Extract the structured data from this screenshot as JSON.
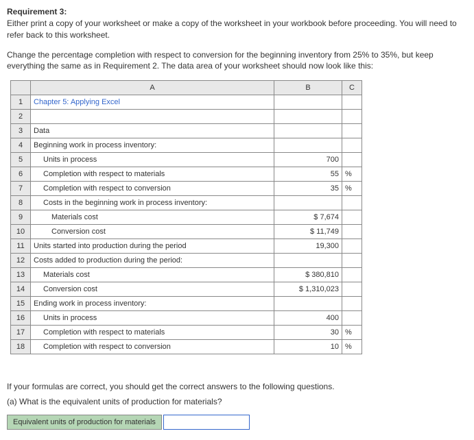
{
  "requirement": {
    "title": "Requirement 3:",
    "paragraph1": "Either print a copy of your worksheet or make a copy of the worksheet in your workbook before proceeding. You will need to refer back to this worksheet.",
    "paragraph2": "Change the percentage completion with respect to conversion for the beginning inventory from 25% to 35%, but keep everything the same as in Requirement 2. The data area of your worksheet should now look like this:"
  },
  "headers": {
    "colA": "A",
    "colB": "B",
    "colC": "C"
  },
  "rows": [
    {
      "num": "1",
      "a": "Chapter 5: Applying Excel",
      "b": "",
      "c": "",
      "blue": true
    },
    {
      "num": "2",
      "a": "",
      "b": "",
      "c": ""
    },
    {
      "num": "3",
      "a": "Data",
      "b": "",
      "c": ""
    },
    {
      "num": "4",
      "a": "Beginning work in process inventory:",
      "b": "",
      "c": ""
    },
    {
      "num": "5",
      "a": "Units in process",
      "b": "700",
      "c": "",
      "indent": 1
    },
    {
      "num": "6",
      "a": "Completion with respect to materials",
      "b": "55",
      "c": "%",
      "indent": 1
    },
    {
      "num": "7",
      "a": "Completion with respect to conversion",
      "b": "35",
      "c": "%",
      "indent": 1
    },
    {
      "num": "8",
      "a": "Costs in the beginning work in process inventory:",
      "b": "",
      "c": "",
      "indent": 1
    },
    {
      "num": "9",
      "a": "Materials cost",
      "b": "$      7,674",
      "c": "",
      "indent": 2
    },
    {
      "num": "10",
      "a": "Conversion cost",
      "b": "$     11,749",
      "c": "",
      "indent": 2
    },
    {
      "num": "11",
      "a": "Units started into production during the period",
      "b": "19,300",
      "c": ""
    },
    {
      "num": "12",
      "a": "Costs added to production during the period:",
      "b": "",
      "c": ""
    },
    {
      "num": "13",
      "a": "Materials cost",
      "b": "$   380,810",
      "c": "",
      "indent": 1
    },
    {
      "num": "14",
      "a": "Conversion cost",
      "b": "$ 1,310,023",
      "c": "",
      "indent": 1
    },
    {
      "num": "15",
      "a": "Ending work in process inventory:",
      "b": "",
      "c": ""
    },
    {
      "num": "16",
      "a": "Units in process",
      "b": "400",
      "c": "",
      "indent": 1
    },
    {
      "num": "17",
      "a": "Completion with respect to materials",
      "b": "30",
      "c": "%",
      "indent": 1
    },
    {
      "num": "18",
      "a": "Completion with respect to conversion",
      "b": "10",
      "c": "%",
      "indent": 1
    }
  ],
  "footer": {
    "line1": "If your formulas are correct, you should get the correct answers to the following questions.",
    "line2": "(a) What is the equivalent units of production for materials?",
    "inputLabel": "Equivalent units of production for materials"
  }
}
